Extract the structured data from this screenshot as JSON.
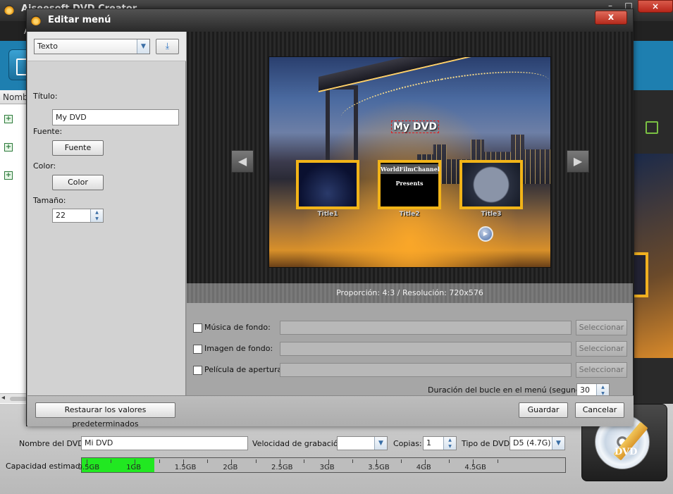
{
  "app": {
    "title": "Aiseesoft DVD Creator",
    "menu_letter": "A",
    "list_header": "Nombre"
  },
  "bottom": {
    "dvd_name_label": "Nombre del DVD:",
    "dvd_name_value": "Mi DVD",
    "burn_speed_label": "Velocidad de grabación:",
    "burn_speed_value": "",
    "copies_label": "Copias:",
    "copies_value": "1",
    "dvd_type_label": "Tipo de DVD:",
    "dvd_type_value": "D5 (4.7G)",
    "capacity_label": "Capacidad estimada:",
    "capacity_fill_gb": 0.75,
    "capacity_max_gb": 5.0,
    "capacity_ticks": [
      "0.5GB",
      "1GB",
      "1.5GB",
      "2GB",
      "2.5GB",
      "3GB",
      "3.5GB",
      "4GB",
      "4.5GB"
    ],
    "logo_text": "DVD"
  },
  "dialog": {
    "title": "Editar menú",
    "close_label": "x",
    "mode_select": "Texto",
    "title_label": "Título:",
    "title_value": "My DVD",
    "font_label": "Fuente:",
    "font_button": "Fuente",
    "color_label": "Color:",
    "color_button": "Color",
    "size_label": "Tamaño:",
    "size_value": "22",
    "preview": {
      "menu_title": "My DVD",
      "thumbs": [
        {
          "caption": "Title1"
        },
        {
          "caption": "Title2",
          "line1": "WorldFilmChannel",
          "line2": "Presents"
        },
        {
          "caption": "Title3"
        }
      ]
    },
    "ratio_text": "Proporción: 4:3 / Resolución: 720x576",
    "options": [
      {
        "label": "Música de fondo:",
        "button": "Seleccionar"
      },
      {
        "label": "Imagen de fondo:",
        "button": "Seleccionar"
      },
      {
        "label": "Película de apertura:",
        "button": "Seleccionar"
      }
    ],
    "loop_label": "Duración del bucle en el menú (segundos):",
    "loop_value": "30",
    "restore_button": "Restaurar los valores predeterminados",
    "save_button": "Guardar",
    "cancel_button": "Cancelar"
  },
  "colors": {
    "toolbar_blue": "#1e7fb0",
    "capacity_green": "#21e821",
    "thumb_border": "#f2b418",
    "close_red": "#b52a1c"
  }
}
